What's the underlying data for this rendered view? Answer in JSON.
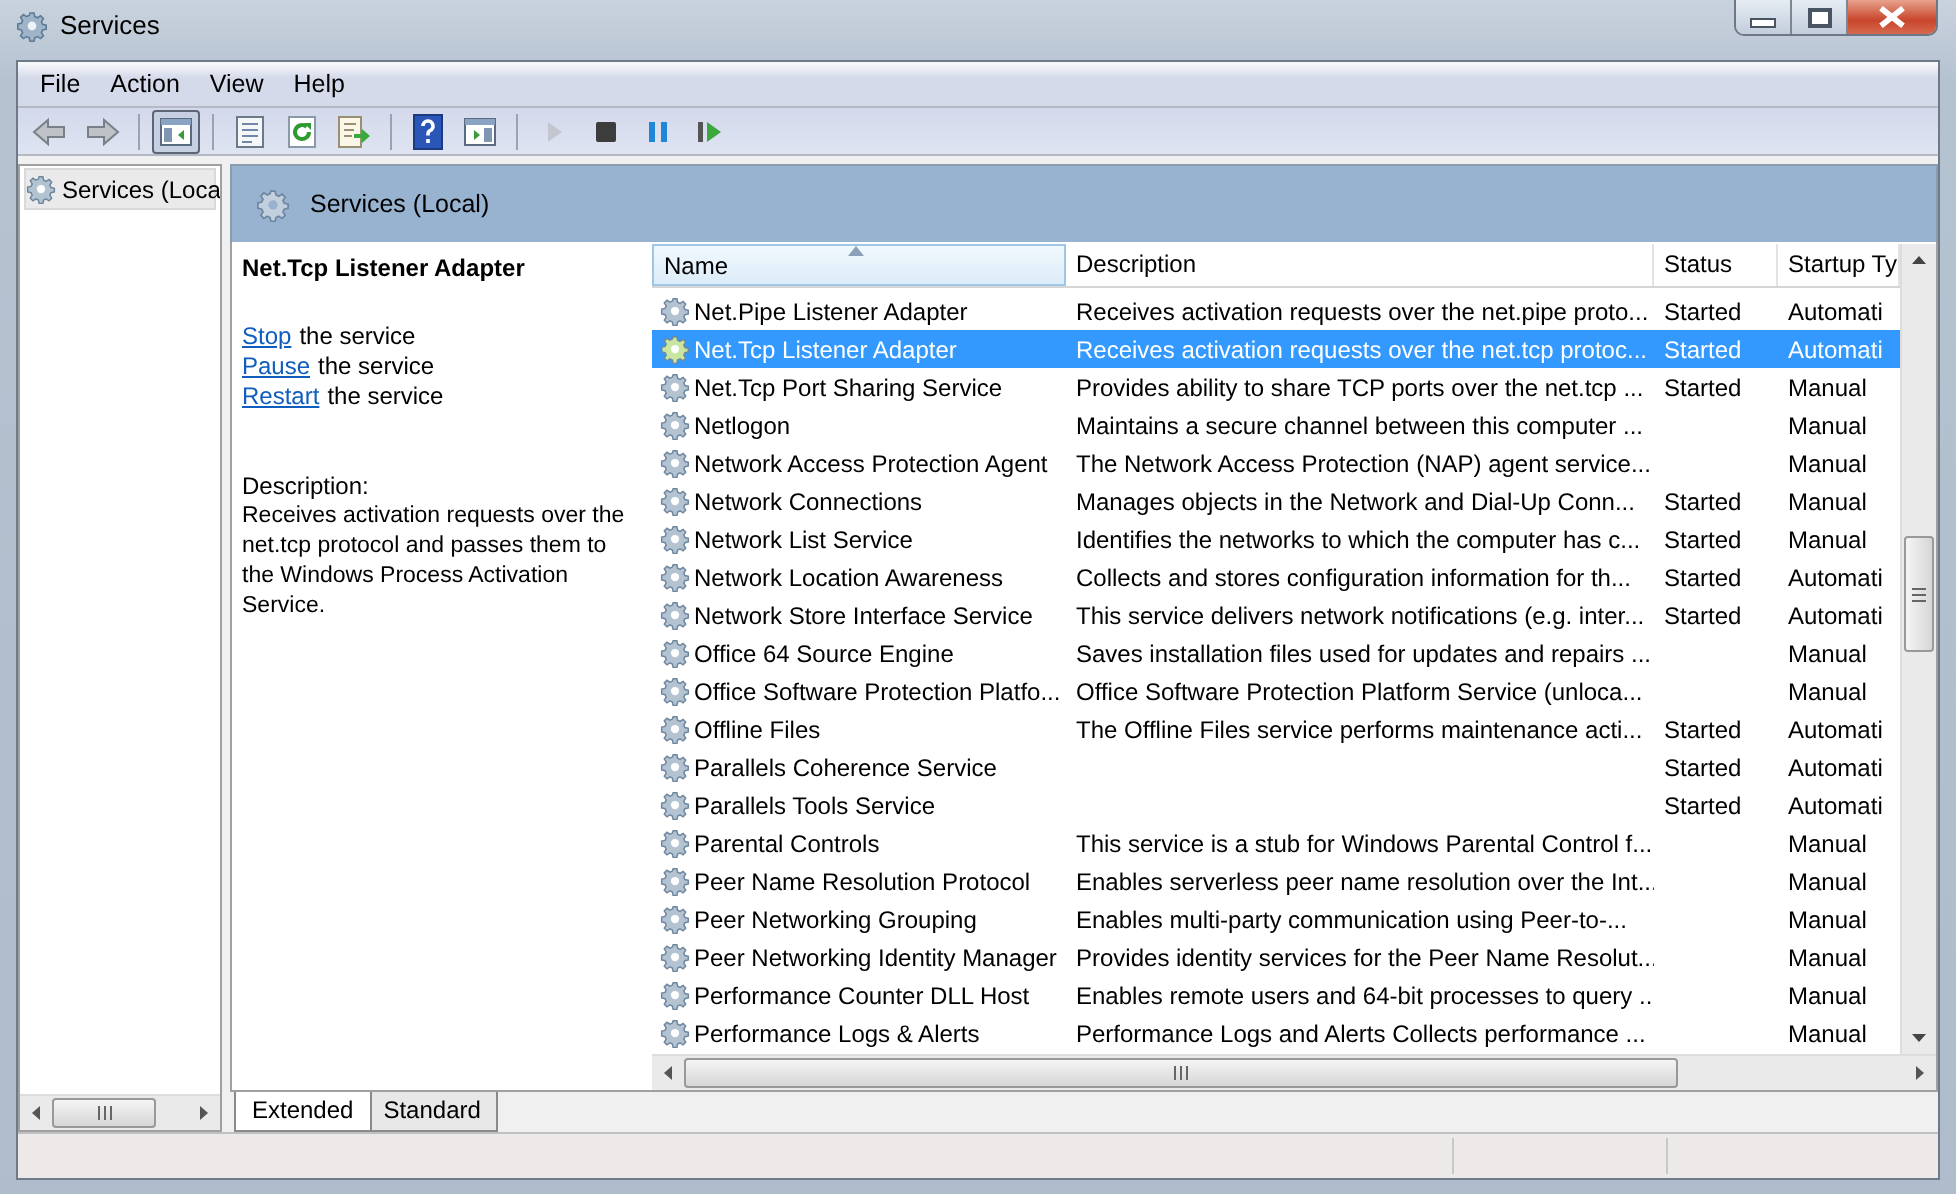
{
  "window": {
    "title": "Services"
  },
  "menu": [
    "File",
    "Action",
    "View",
    "Help"
  ],
  "toolbar": [
    [
      {
        "kind": "back",
        "disabled": false,
        "pressed": false
      },
      {
        "kind": "forward",
        "disabled": false,
        "pressed": false
      }
    ],
    [
      {
        "kind": "tree",
        "disabled": false,
        "pressed": true
      }
    ],
    [
      {
        "kind": "properties",
        "disabled": false,
        "pressed": false
      },
      {
        "kind": "refresh",
        "disabled": false,
        "pressed": false
      },
      {
        "kind": "export",
        "disabled": false,
        "pressed": false
      }
    ],
    [
      {
        "kind": "help",
        "disabled": false,
        "pressed": false
      },
      {
        "kind": "actionpane",
        "disabled": false,
        "pressed": false
      }
    ],
    [
      {
        "kind": "play",
        "disabled": true,
        "pressed": false
      },
      {
        "kind": "stop",
        "disabled": false,
        "pressed": false
      },
      {
        "kind": "pause",
        "disabled": false,
        "pressed": false
      },
      {
        "kind": "resume",
        "disabled": false,
        "pressed": false
      }
    ]
  ],
  "tree": {
    "items": [
      {
        "label": "Services (Loca",
        "selected": true
      }
    ]
  },
  "pane_header": "Services (Local)",
  "details": {
    "title": "Net.Tcp Listener Adapter",
    "actions": [
      {
        "link": "Stop",
        "text": "the service"
      },
      {
        "link": "Pause",
        "text": "the service"
      },
      {
        "link": "Restart",
        "text": "the service"
      }
    ],
    "description_label": "Description:",
    "description": "Receives activation requests over the net.tcp protocol and passes them to the Windows Process Activation Service."
  },
  "table": {
    "columns": [
      "Name",
      "Description",
      "Status",
      "Startup Ty"
    ],
    "rows": [
      {
        "name": "Net.Pipe Listener Adapter",
        "description": "Receives activation requests over the net.pipe proto...",
        "status": "Started",
        "startup": "Automati",
        "selected": false
      },
      {
        "name": "Net.Tcp Listener Adapter",
        "description": "Receives activation requests over the net.tcp protoc...",
        "status": "Started",
        "startup": "Automati",
        "selected": true
      },
      {
        "name": "Net.Tcp Port Sharing Service",
        "description": "Provides ability to share TCP ports over the net.tcp ...",
        "status": "Started",
        "startup": "Manual",
        "selected": false
      },
      {
        "name": "Netlogon",
        "description": "Maintains a secure channel between this computer ...",
        "status": "",
        "startup": "Manual",
        "selected": false
      },
      {
        "name": "Network Access Protection Agent",
        "description": "The Network Access Protection (NAP) agent service...",
        "status": "",
        "startup": "Manual",
        "selected": false
      },
      {
        "name": "Network Connections",
        "description": "Manages objects in the Network and Dial-Up Conn...",
        "status": "Started",
        "startup": "Manual",
        "selected": false
      },
      {
        "name": "Network List Service",
        "description": "Identifies the networks to which the computer has c...",
        "status": "Started",
        "startup": "Manual",
        "selected": false
      },
      {
        "name": "Network Location Awareness",
        "description": "Collects and stores configuration information for th...",
        "status": "Started",
        "startup": "Automati",
        "selected": false
      },
      {
        "name": "Network Store Interface Service",
        "description": "This service delivers network notifications (e.g. inter...",
        "status": "Started",
        "startup": "Automati",
        "selected": false
      },
      {
        "name": "Office 64 Source Engine",
        "description": "Saves installation files used for updates and repairs ...",
        "status": "",
        "startup": "Manual",
        "selected": false
      },
      {
        "name": "Office Software Protection Platfo...",
        "description": "Office Software Protection Platform Service (unloca...",
        "status": "",
        "startup": "Manual",
        "selected": false
      },
      {
        "name": "Offline Files",
        "description": "The Offline Files service performs maintenance acti...",
        "status": "Started",
        "startup": "Automati",
        "selected": false
      },
      {
        "name": "Parallels Coherence Service",
        "description": "",
        "status": "Started",
        "startup": "Automati",
        "selected": false
      },
      {
        "name": "Parallels Tools Service",
        "description": "",
        "status": "Started",
        "startup": "Automati",
        "selected": false
      },
      {
        "name": "Parental Controls",
        "description": "This service is a stub for Windows Parental Control f...",
        "status": "",
        "startup": "Manual",
        "selected": false
      },
      {
        "name": "Peer Name Resolution Protocol",
        "description": "Enables serverless peer name resolution over the Int...",
        "status": "",
        "startup": "Manual",
        "selected": false
      },
      {
        "name": "Peer Networking Grouping",
        "description": "Enables multi-party communication using Peer-to-...",
        "status": "",
        "startup": "Manual",
        "selected": false
      },
      {
        "name": "Peer Networking Identity Manager",
        "description": "Provides identity services for the Peer Name Resolut...",
        "status": "",
        "startup": "Manual",
        "selected": false
      },
      {
        "name": "Performance Counter DLL Host",
        "description": "Enables remote users and 64-bit processes to query ...",
        "status": "",
        "startup": "Manual",
        "selected": false
      },
      {
        "name": "Performance Logs & Alerts",
        "description": "Performance Logs and Alerts Collects performance ...",
        "status": "",
        "startup": "Manual",
        "selected": false
      }
    ]
  },
  "tabs": [
    {
      "label": "Extended",
      "selected": true
    },
    {
      "label": "Standard",
      "selected": false
    }
  ]
}
